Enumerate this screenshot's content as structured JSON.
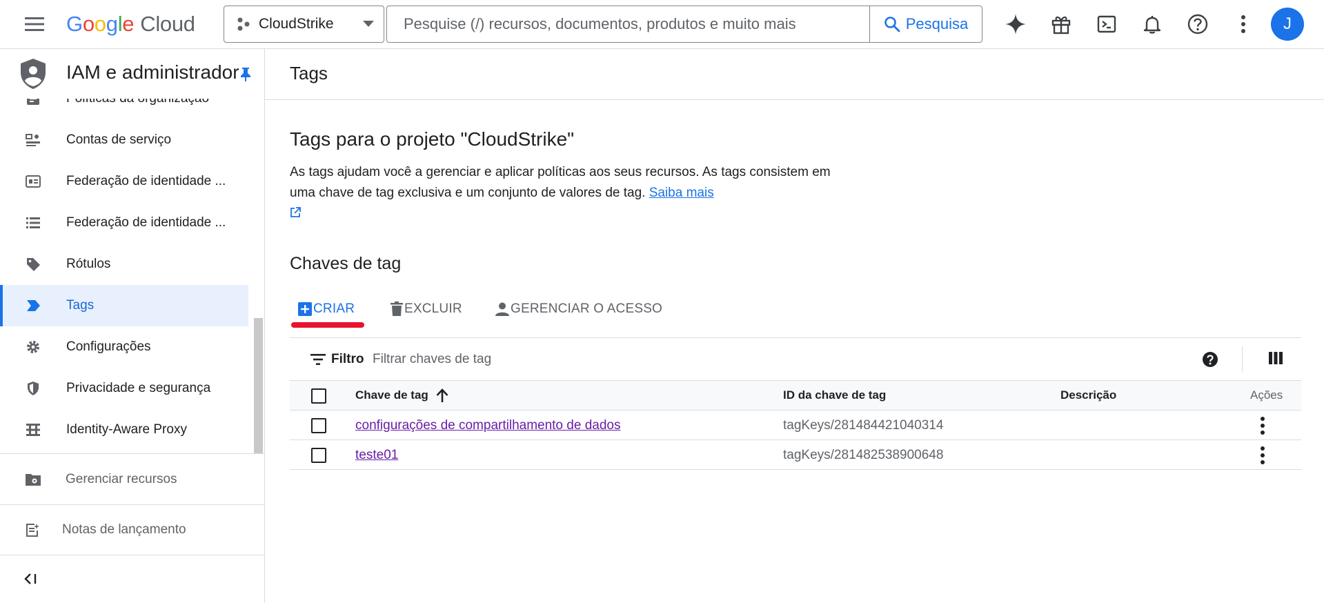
{
  "topbar": {
    "logo_letters": [
      "G",
      "o",
      "o",
      "g",
      "l",
      "e"
    ],
    "logo_suffix": "Cloud",
    "project": "CloudStrike",
    "search_placeholder": "Pesquise (/) recursos, documentos, produtos e muito mais",
    "search_button": "Pesquisa",
    "avatar_letter": "J"
  },
  "sidebar": {
    "title": "IAM e administrador",
    "items": [
      {
        "label": "Políticas da organização",
        "icon": "policy-icon"
      },
      {
        "label": "Contas de serviço",
        "icon": "service-account-icon"
      },
      {
        "label": "Federação de identidade ...",
        "icon": "identity-card-icon"
      },
      {
        "label": "Federação de identidade ...",
        "icon": "list-icon"
      },
      {
        "label": "Rótulos",
        "icon": "label-icon"
      },
      {
        "label": "Tags",
        "icon": "tag-icon",
        "active": true
      },
      {
        "label": "Configurações",
        "icon": "gear-icon"
      },
      {
        "label": "Privacidade e segurança",
        "icon": "shield-icon"
      },
      {
        "label": "Identity-Aware Proxy",
        "icon": "proxy-icon"
      }
    ],
    "manage_resources": "Gerenciar recursos",
    "release_notes": "Notas de lançamento"
  },
  "main": {
    "header": "Tags",
    "section_title": "Tags para o projeto \"CloudStrike\"",
    "description": "As tags ajudam você a gerenciar e aplicar políticas aos seus recursos. As tags consistem em uma chave de tag exclusiva e um conjunto de valores de tag.",
    "learn_more": "Saiba mais",
    "keys_title": "Chaves de tag",
    "actions": {
      "create": "CRIAR",
      "delete": "EXCLUIR",
      "manage_access": "GERENCIAR O ACESSO"
    },
    "filter": {
      "label": "Filtro",
      "placeholder": "Filtrar chaves de tag"
    },
    "table": {
      "columns": [
        "Chave de tag",
        "ID da chave de tag",
        "Descrição",
        "Ações"
      ],
      "rows": [
        {
          "key": "configurações de compartilhamento de dados",
          "id": "tagKeys/281484421040314",
          "description": ""
        },
        {
          "key": "teste01",
          "id": "tagKeys/281482538900648",
          "description": ""
        }
      ]
    }
  },
  "colors": {
    "accent": "#1a73e8",
    "highlight_underline": "#e8132c",
    "link_visited": "#681da8"
  }
}
